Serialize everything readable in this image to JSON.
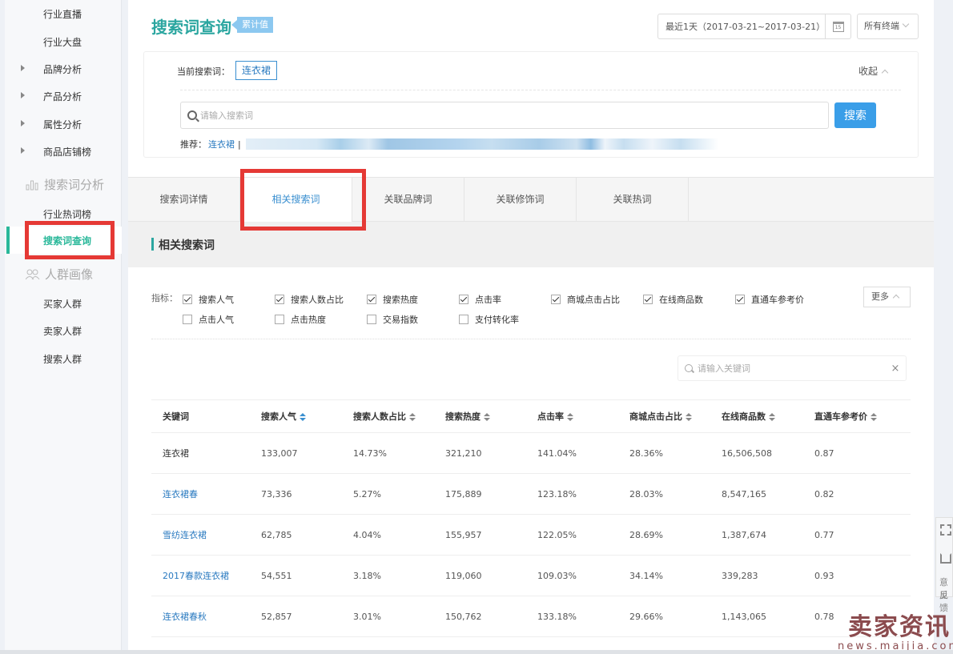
{
  "sidebar": {
    "items_top": [
      {
        "label": "行业直播",
        "arrow": false
      },
      {
        "label": "行业大盘",
        "arrow": false
      },
      {
        "label": "品牌分析",
        "arrow": true
      },
      {
        "label": "产品分析",
        "arrow": true
      },
      {
        "label": "属性分析",
        "arrow": true
      },
      {
        "label": "商品店铺榜",
        "arrow": true
      }
    ],
    "group_search": {
      "label": "搜索词分析",
      "icon": "bar-chart-icon"
    },
    "search_items": [
      {
        "label": "行业热词榜"
      },
      {
        "label": "搜索词查询",
        "active": true
      }
    ],
    "group_crowd": {
      "label": "人群画像",
      "icon": "users-icon"
    },
    "crowd_items": [
      {
        "label": "买家人群"
      },
      {
        "label": "卖家人群"
      },
      {
        "label": "搜索人群"
      }
    ]
  },
  "header": {
    "title": "搜索词查询",
    "tag": "累计值",
    "date_range": "最近1天（2017-03-21~2017-03-21）",
    "calendar_day": "15",
    "terminal": "所有终端"
  },
  "search_panel": {
    "current_label": "当前搜索词：",
    "current_term": "连衣裙",
    "collapse_label": "收起",
    "input_placeholder": "请输入搜索词",
    "input_value": "",
    "search_button": "搜索",
    "recommend_label": "推荐：",
    "recommend_link": "连衣裙",
    "recommend_sep": "|"
  },
  "tabs": [
    {
      "label": "搜索词详情",
      "active": false
    },
    {
      "label": "相关搜索词",
      "active": true
    },
    {
      "label": "关联品牌词",
      "active": false
    },
    {
      "label": "关联修饰词",
      "active": false
    },
    {
      "label": "关联热词",
      "active": false
    }
  ],
  "section_title": "相关搜索词",
  "metrics": {
    "label": "指标：",
    "row1": [
      {
        "label": "搜索人气",
        "checked": true
      },
      {
        "label": "搜索人数占比",
        "checked": true
      },
      {
        "label": "搜索热度",
        "checked": true
      },
      {
        "label": "点击率",
        "checked": true
      },
      {
        "label": "商城点击占比",
        "checked": true
      },
      {
        "label": "在线商品数",
        "checked": true
      },
      {
        "label": "直通车参考价",
        "checked": true
      }
    ],
    "row2": [
      {
        "label": "点击人气",
        "checked": false
      },
      {
        "label": "点击热度",
        "checked": false
      },
      {
        "label": "交易指数",
        "checked": false
      },
      {
        "label": "支付转化率",
        "checked": false
      }
    ],
    "more_label": "更多"
  },
  "keyword_filter": {
    "placeholder": "请输入关键词",
    "value": "",
    "clear": "×"
  },
  "table": {
    "columns": [
      {
        "label": "关键词",
        "sortable": false
      },
      {
        "label": "搜索人气",
        "sortable": true,
        "active": true
      },
      {
        "label": "搜索人数占比",
        "sortable": true
      },
      {
        "label": "搜索热度",
        "sortable": true
      },
      {
        "label": "点击率",
        "sortable": true
      },
      {
        "label": "商城点击占比",
        "sortable": true
      },
      {
        "label": "在线商品数",
        "sortable": true
      },
      {
        "label": "直通车参考价",
        "sortable": true
      }
    ],
    "rows": [
      {
        "keyword": "连衣裙",
        "link": false,
        "popularity": "133,007",
        "share": "14.73%",
        "heat": "321,210",
        "ctr": "141.04%",
        "mall_share": "28.36%",
        "items": "16,506,508",
        "price": "0.87"
      },
      {
        "keyword": "连衣裙春",
        "link": true,
        "popularity": "73,336",
        "share": "5.27%",
        "heat": "175,889",
        "ctr": "123.18%",
        "mall_share": "28.03%",
        "items": "8,547,165",
        "price": "0.82"
      },
      {
        "keyword": "雪纺连衣裙",
        "link": true,
        "popularity": "62,785",
        "share": "4.04%",
        "heat": "155,957",
        "ctr": "122.05%",
        "mall_share": "28.69%",
        "items": "1,387,674",
        "price": "0.77"
      },
      {
        "keyword": "2017春款连衣裙",
        "link": true,
        "popularity": "54,551",
        "share": "3.18%",
        "heat": "119,060",
        "ctr": "109.03%",
        "mall_share": "34.14%",
        "items": "339,283",
        "price": "0.93"
      },
      {
        "keyword": "连衣裙春秋",
        "link": true,
        "popularity": "52,857",
        "share": "3.01%",
        "heat": "150,762",
        "ctr": "133.18%",
        "mall_share": "29.66%",
        "items": "1,143,065",
        "price": "0.78"
      }
    ]
  },
  "float_tool": {
    "feedback_line1": "意见",
    "feedback_line2": "反馈"
  },
  "watermark": {
    "main": "卖家资讯",
    "sub": "news.maijia.com"
  },
  "colors": {
    "accent_teal": "#2ba6a0",
    "active_green": "#2ab89a",
    "link_blue": "#2a7ac0",
    "button_blue": "#3a9ee8",
    "highlight_red": "#e53935"
  }
}
